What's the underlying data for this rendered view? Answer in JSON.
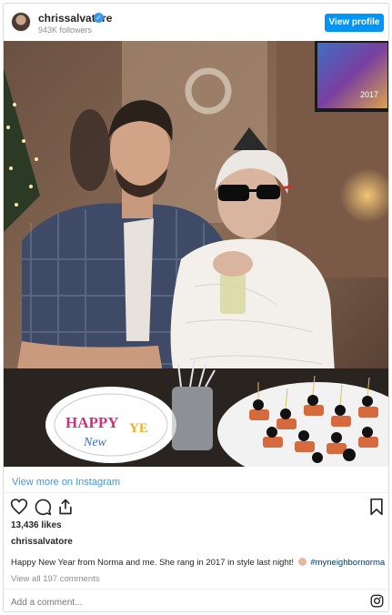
{
  "header": {
    "username": "chrissalvatore",
    "verified_icon": "verified-check-icon",
    "followers": "943K followers",
    "view_profile_label": "View profile"
  },
  "photo": {
    "plate_text_1": "HAPPY",
    "plate_text_2": "New",
    "plate_text_3": "YE",
    "tv_text": "2017"
  },
  "view_more_label": "View more on Instagram",
  "actions": {
    "like_icon": "heart-icon",
    "comment_icon": "comment-icon",
    "share_icon": "share-icon",
    "save_icon": "bookmark-icon"
  },
  "likes": "13,436 likes",
  "post_author": "chrissalvatore",
  "caption": {
    "text": "Happy New Year from Norma and me. She rang in 2017 in style last night!",
    "hashtag": "#myneighbornorma"
  },
  "view_all_comments": "View all 197 comments",
  "comment_placeholder": "Add a comment...",
  "instagram_icon": "instagram-logo-icon",
  "colors": {
    "primary_blue": "#0095f6",
    "link_blue": "#3897f0",
    "text": "#262626",
    "muted": "#8e8e8e",
    "border": "#dbdbdb"
  }
}
